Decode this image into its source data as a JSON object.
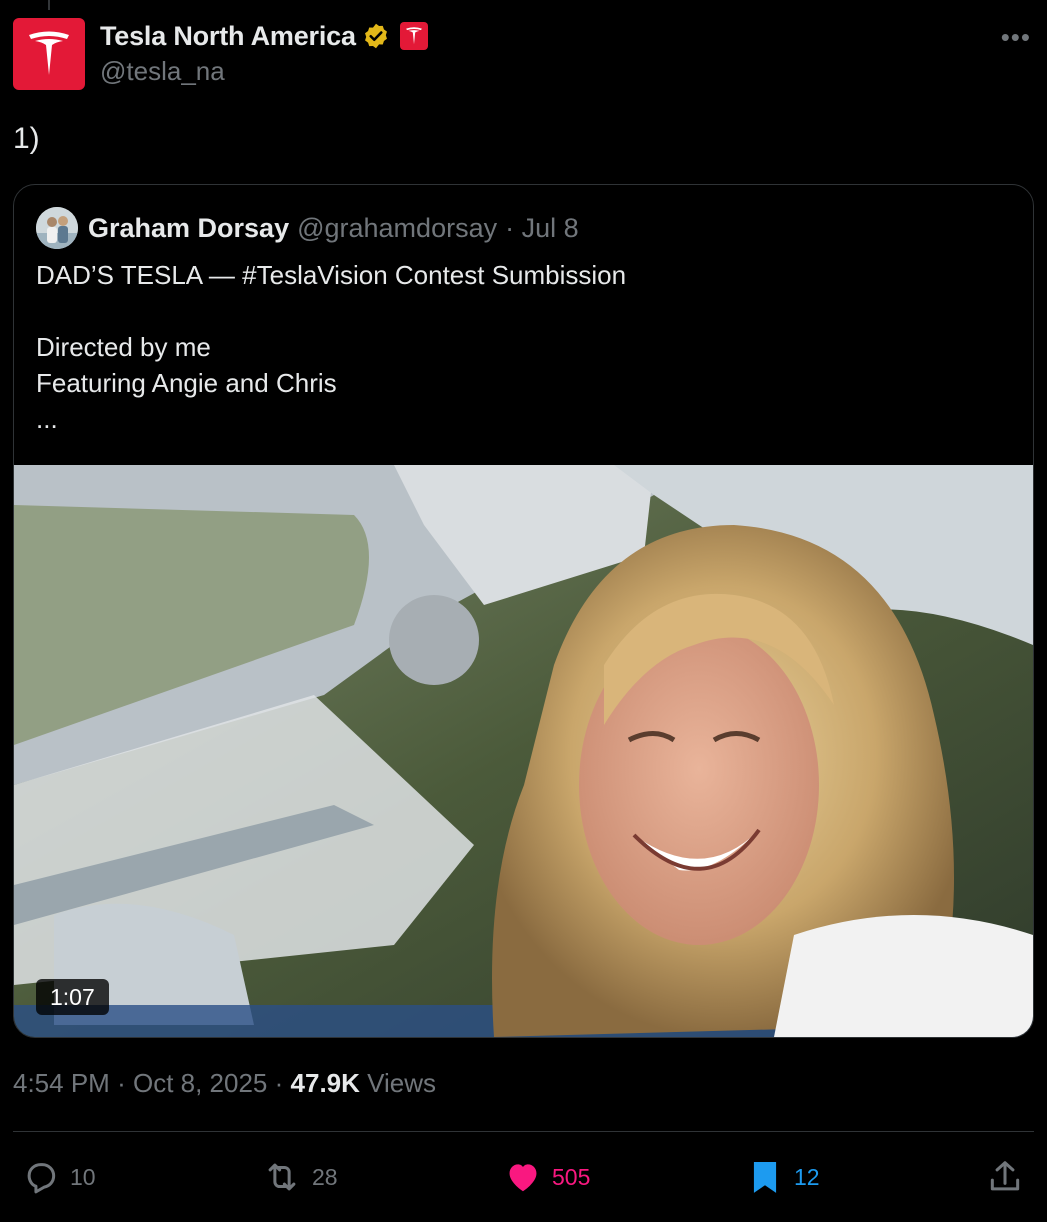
{
  "author": {
    "display_name": "Tesla North America",
    "handle": "@tesla_na",
    "verified_icon": "verified-badge-gold",
    "affiliate_icon": "tesla-logo"
  },
  "post": {
    "text": "1)",
    "time": "4:54 PM",
    "date": "Oct 8, 2025",
    "views_count": "47.9K",
    "views_label": "Views",
    "separator": "·"
  },
  "quoted": {
    "display_name": "Graham Dorsay",
    "handle": "@grahamdorsay",
    "date": "· Jul 8",
    "body": "DAD’S TESLA — #TeslaVision Contest Sumbission\n\nDirected by me\nFeaturing Angie and Chris\n...",
    "video_duration": "1:07"
  },
  "actions": {
    "replies": "10",
    "reposts": "28",
    "likes": "505",
    "bookmarks": "12"
  },
  "colors": {
    "brand_red": "#e31937",
    "like": "#f91880",
    "bookmark": "#1d9bf0",
    "muted": "#71767b"
  }
}
